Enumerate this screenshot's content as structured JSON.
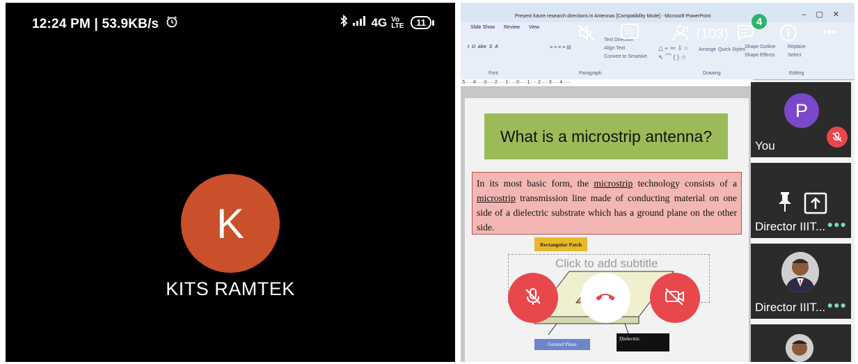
{
  "left_phone": {
    "status": {
      "time_speed": "12:24 PM | 53.9KB/s",
      "network": "4G",
      "volte": "Vo LTE",
      "battery": "11"
    },
    "caller": {
      "initial": "K",
      "name": "KITS RAMTEK",
      "avatar_color": "#c9502b"
    }
  },
  "right_meeting": {
    "ppt": {
      "window_title": "Present future research directions in Antennas [Compatibility Mode] - Microsoft PowerPoint",
      "tabs": [
        "Slide Show",
        "Review",
        "View"
      ],
      "groups": [
        "Font",
        "Paragraph",
        "Drawing",
        "Editing"
      ],
      "ribbon_items": {
        "text_direction": "Text Direction",
        "align_text": "Align Text",
        "convert_smartart": "Convert to SmartArt",
        "arrange": "Arrange",
        "quick_styles": "Quick Styles",
        "shape_outline": "Shape Outline",
        "shape_effects": "Shape Effects",
        "replace": "Replace",
        "select": "Select"
      },
      "ruler": "·5·····4·····3·····2·····1·····0·····1·····2·····3·····4·····",
      "slide": {
        "title": "What is a microstrip antenna?",
        "body_parts": {
          "p1": "In its most basic form, the ",
          "u1": "microstrip",
          "p2": " technology consists of a ",
          "u2": "microstrip",
          "p3": " transmission line made of conducting material on one side of a dielectric substrate which has a ground plane on the other side."
        },
        "subtitle_placeholder": "Click to add subtitle",
        "label_patch": "Rectangular Patch",
        "label_ground": "Ground Plane",
        "label_dielectric": "Dielectric"
      }
    },
    "toolbar": {
      "participant_count": "(103)",
      "chat_badge": "4",
      "more": "•••"
    },
    "participants": [
      {
        "name": "You",
        "initial": "P",
        "color": "#7a48c9"
      },
      {
        "name": "Director IIIT...",
        "dots": "●●●"
      },
      {
        "name": "Director IIIT...",
        "dots": "●●●"
      }
    ],
    "colors": {
      "danger": "#e8474c",
      "accent": "#2fb36e",
      "slide_title_bg": "#9bbb59",
      "slide_body_bg": "#f2b7b4"
    }
  }
}
